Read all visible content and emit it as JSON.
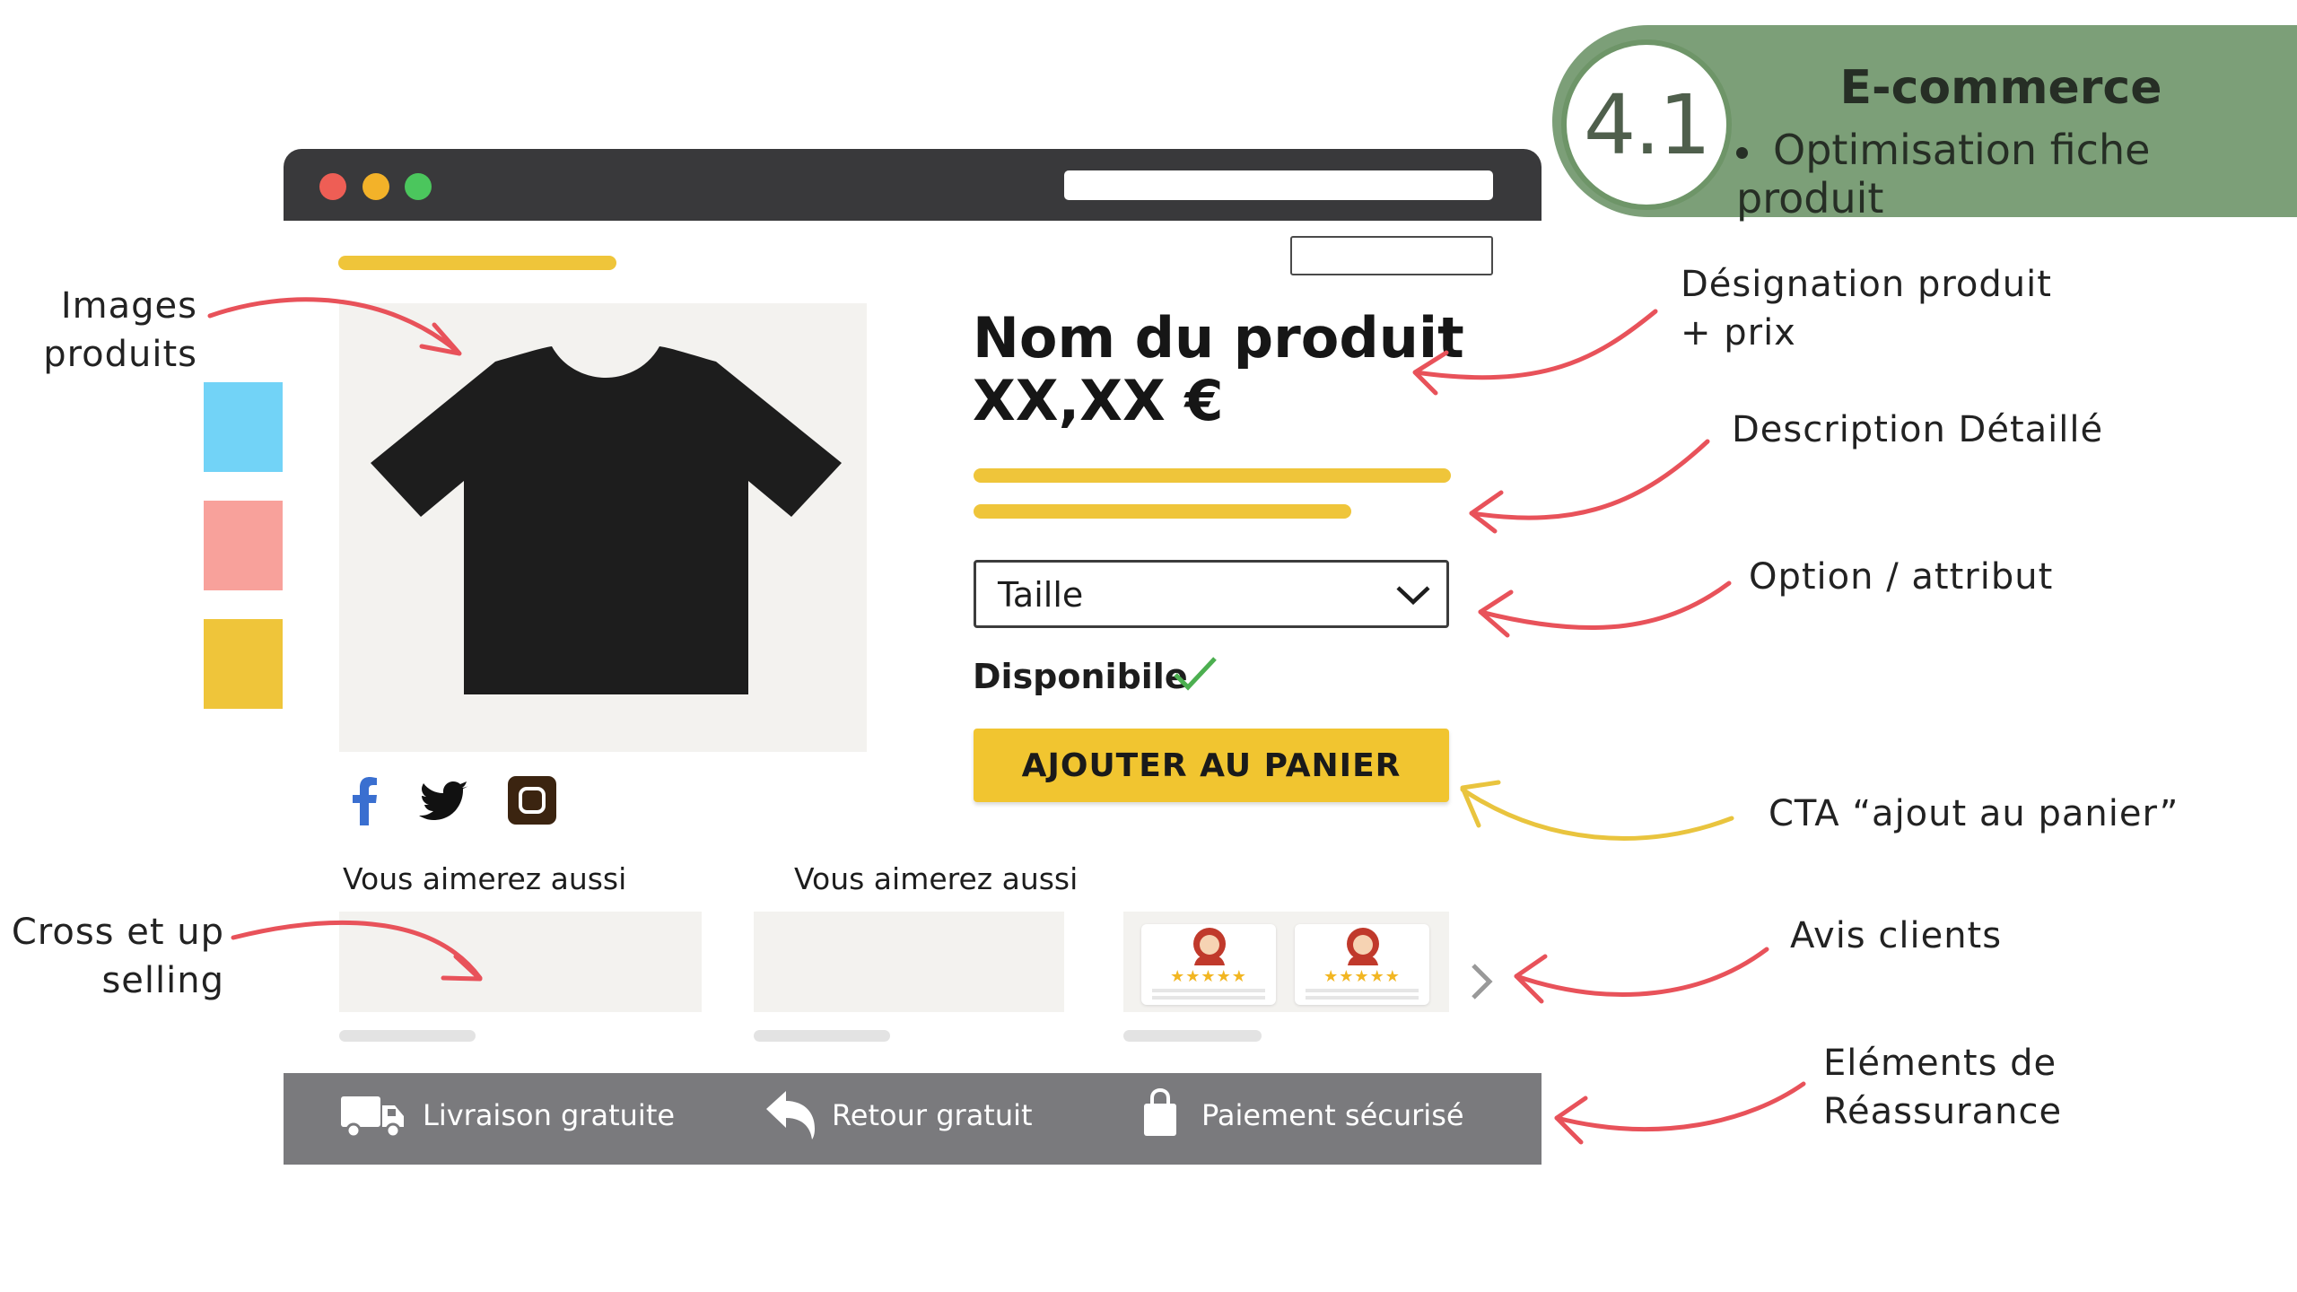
{
  "badge": {
    "number": "4.1",
    "title": "E-commerce",
    "subtitle": "Optimisation fiche produit"
  },
  "product": {
    "name": "Nom du produit",
    "price": "XX,XX €",
    "size_select_label": "Taille",
    "availability": "Disponibile",
    "cta_label": "AJOUTER AU PANIER"
  },
  "cross_sell": {
    "labels": [
      "Vous aimerez aussi",
      "Vous aimerez aussi"
    ],
    "review_stars": "★★★★★"
  },
  "reassurance": {
    "shipping": "Livraison gratuite",
    "returns": "Retour gratuit",
    "payment": "Paiement sécurisé"
  },
  "annotations": {
    "images_line1": "Images",
    "images_line2": "produits",
    "designation_line1": "Désignation produit",
    "designation_line2": "+ prix",
    "description": "Description Détaillé",
    "option": "Option / attribut",
    "cta": "CTA “ajout au panier”",
    "reviews": "Avis clients",
    "cross_line1": "Cross et up",
    "cross_line2": "selling",
    "reassurance_line1": "Eléments de",
    "reassurance_line2": "Réassurance"
  },
  "colors": {
    "badge_green": "#7c9f78",
    "accent_yellow": "#efc53a",
    "arrow_red": "#e8525a",
    "browser_dark": "#39393b",
    "reassurance_gray": "#7a7a7d",
    "thumb_blue": "#72d3f7",
    "thumb_pink": "#f8a19b",
    "thumb_yellow": "#efc53a",
    "check_green": "#4caf50"
  },
  "icons": [
    "facebook-icon",
    "twitter-icon",
    "instagram-icon",
    "truck-icon",
    "return-arrow-icon",
    "shopping-bag-icon",
    "chevron-down-icon",
    "check-icon",
    "chevron-right-icon",
    "tshirt-icon"
  ]
}
